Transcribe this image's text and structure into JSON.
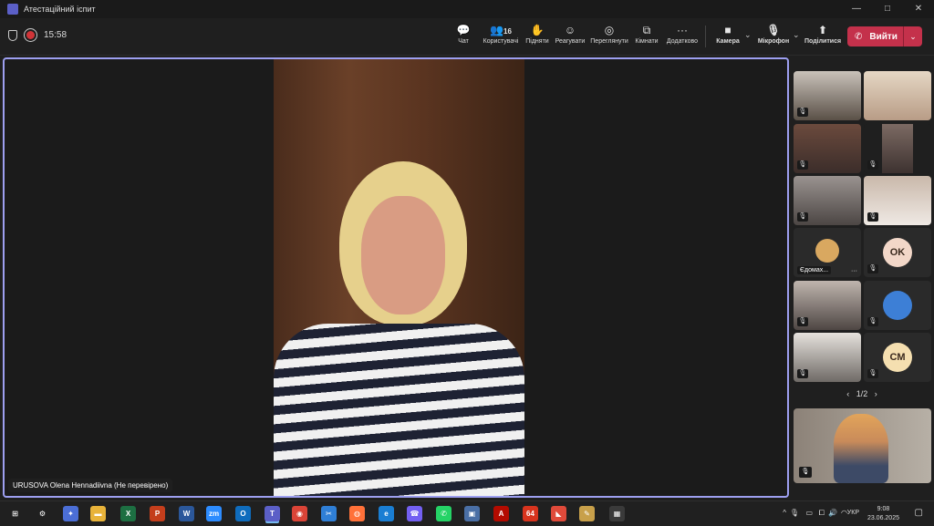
{
  "window": {
    "title": "Атестаційний іспит",
    "controls": [
      "—",
      "□",
      "✕"
    ]
  },
  "meeting": {
    "timer": "15:58"
  },
  "toolbar": {
    "items": [
      {
        "label": "Чат",
        "icon": "chat-icon",
        "glyph": "💬"
      },
      {
        "label": "Користувачі",
        "icon": "people-icon",
        "glyph": "👥",
        "count": "16"
      },
      {
        "label": "Підняти",
        "icon": "raise-hand-icon",
        "glyph": "✋"
      },
      {
        "label": "Реагувати",
        "icon": "react-icon",
        "glyph": "☺"
      },
      {
        "label": "Переглянути",
        "icon": "view-icon",
        "glyph": "◎"
      },
      {
        "label": "Кімнати",
        "icon": "rooms-icon",
        "glyph": "⧉"
      },
      {
        "label": "Додатково",
        "icon": "more-icon",
        "glyph": "···"
      },
      {
        "label": "Камера",
        "icon": "camera-icon",
        "glyph": "■"
      },
      {
        "label": "Мікрофон",
        "icon": "microphone-icon",
        "glyph": "🎙"
      },
      {
        "label": "Поділитися",
        "icon": "share-icon",
        "glyph": "⬆"
      }
    ],
    "leave_label": "Вийти",
    "chevron": "⌄"
  },
  "main_video": {
    "name_label": "URUSOVA Olena Hennadiivna (Не перевірено)"
  },
  "participants": {
    "tiles": [
      {
        "label": "",
        "avatar": ""
      },
      {
        "label": "",
        "avatar": ""
      },
      {
        "label": "",
        "avatar": ""
      },
      {
        "label": "",
        "avatar": ""
      },
      {
        "label": "",
        "avatar": ""
      },
      {
        "label": "",
        "avatar": ""
      },
      {
        "label": "Єдомах...",
        "avatar": ""
      },
      {
        "label": "",
        "avatar": "OK"
      },
      {
        "label": "",
        "avatar": ""
      },
      {
        "label": "",
        "avatar": ""
      },
      {
        "label": "",
        "avatar": ""
      },
      {
        "label": "",
        "avatar": "CM"
      }
    ],
    "pager": "1/2",
    "prev": "‹",
    "next": "›",
    "more": "···",
    "mic_glyph": "🎙"
  },
  "taskbar": {
    "apps": [
      {
        "name": "windows-start-icon",
        "glyph": "⊞",
        "color": "#202020"
      },
      {
        "name": "settings-icon",
        "glyph": "⚙",
        "color": "#202020"
      },
      {
        "name": "copilot-icon",
        "glyph": "✦",
        "color": "#4b6ed6"
      },
      {
        "name": "file-explorer-icon",
        "glyph": "▬",
        "color": "#e8b33a"
      },
      {
        "name": "excel-icon",
        "glyph": "X",
        "color": "#1d6f42"
      },
      {
        "name": "powerpoint-icon",
        "glyph": "P",
        "color": "#c43e1c"
      },
      {
        "name": "word-icon",
        "glyph": "W",
        "color": "#2b579a"
      },
      {
        "name": "zoom-icon",
        "glyph": "zm",
        "color": "#2d8cff"
      },
      {
        "name": "outlook-icon",
        "glyph": "O",
        "color": "#0f6cbd"
      },
      {
        "name": "teams-icon",
        "glyph": "T",
        "color": "#5b5fc7"
      },
      {
        "name": "chrome-icon",
        "glyph": "◉",
        "color": "#db4437"
      },
      {
        "name": "snipping-tool-icon",
        "glyph": "✂",
        "color": "#2f7fd6"
      },
      {
        "name": "firefox-icon",
        "glyph": "◍",
        "color": "#ff7139"
      },
      {
        "name": "edge-icon",
        "glyph": "e",
        "color": "#1a7ed3"
      },
      {
        "name": "viber-icon",
        "glyph": "☎",
        "color": "#7360f2"
      },
      {
        "name": "whatsapp-icon",
        "glyph": "✆",
        "color": "#25d366"
      },
      {
        "name": "save-icon",
        "glyph": "▣",
        "color": "#4a6fa5"
      },
      {
        "name": "acrobat-icon",
        "glyph": "A",
        "color": "#b30b00"
      },
      {
        "name": "app-64-icon",
        "glyph": "64",
        "color": "#d8341e"
      },
      {
        "name": "app-red-icon",
        "glyph": "◣",
        "color": "#e04a3a"
      },
      {
        "name": "paint-icon",
        "glyph": "✎",
        "color": "#c8a04a"
      },
      {
        "name": "calculator-icon",
        "glyph": "▦",
        "color": "#3a3a3a"
      }
    ],
    "tray": {
      "up": "^",
      "mic": "🎙",
      "battery": "▭",
      "monitor": "⧠",
      "volume": "🔊",
      "wifi": "◠"
    },
    "language": "УКР",
    "time": "9:08",
    "date": "23.06.2025",
    "notification": "▢"
  }
}
